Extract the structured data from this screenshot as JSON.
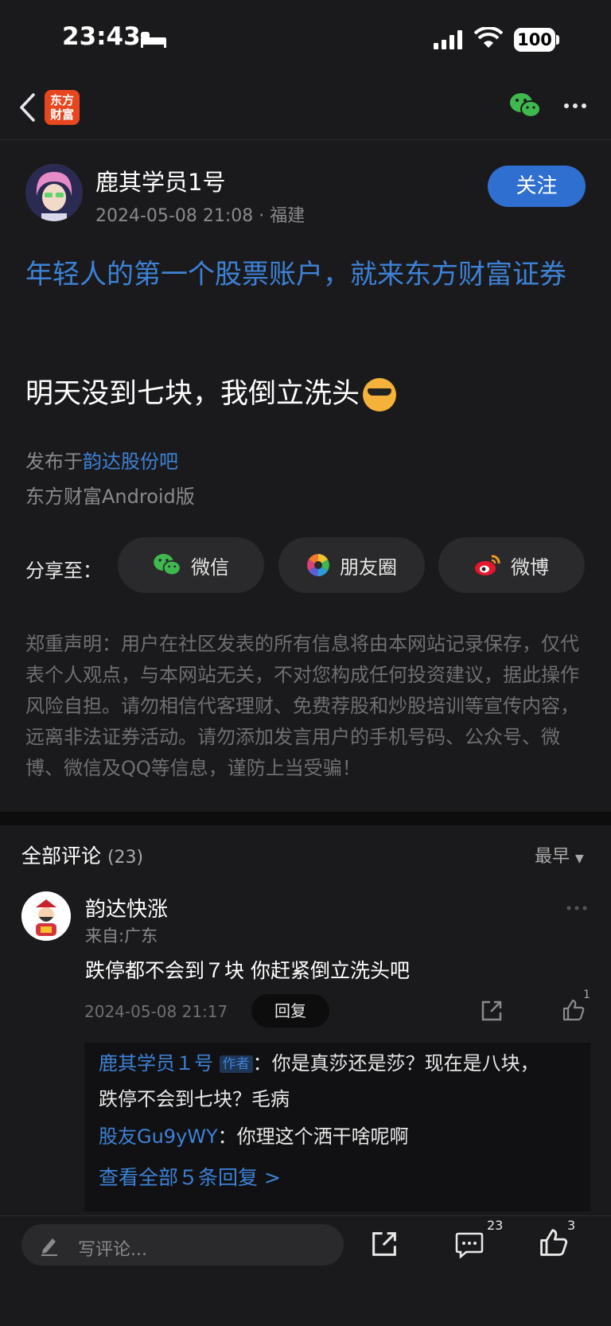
{
  "status": {
    "time": "23:43",
    "battery": "100"
  },
  "nav": {
    "logo_text": "东方\n财富"
  },
  "post": {
    "author": "鹿其学员1号",
    "meta": "2024-05-08 21:08 · 福建",
    "follow_label": "关注",
    "promo": "年轻人的第一个股票账户，就来东方财富证券",
    "body": "明天没到七块，我倒立洗头",
    "published_prefix": "发布于",
    "published_link": "韵达股份吧",
    "client": "东方财富Android版"
  },
  "share": {
    "label": "分享至：",
    "buttons": [
      "微信",
      "朋友圈",
      "微博"
    ]
  },
  "disclaimer": "郑重声明：用户在社区发表的所有信息将由本网站记录保存，仅代表个人观点，与本网站无关，不对您构成任何投资建议，据此操作风险自担。请勿相信代客理财、免费荐股和炒股培训等宣传内容，远离非法证券活动。请勿添加发言用户的手机号码、公众号、微博、微信及QQ等信息，谨防上当受骗！",
  "comments": {
    "title": "全部评论",
    "count": "(23)",
    "sort": "最早",
    "items": [
      {
        "name": "韵达快涨",
        "location": "来自:广东",
        "text": "跌停都不会到７块 你赶紧倒立洗头吧",
        "time": "2024-05-08 21:17",
        "reply_label": "回复",
        "likes": "1",
        "replies": [
          {
            "user": "鹿其学员１号",
            "tag": "作者",
            "text": "：你是真莎还是莎？现在是八块，跌停不会到七块？毛病"
          },
          {
            "user": "股友Gu9yWY",
            "text": "：你理这个洒干啥呢啊"
          }
        ],
        "view_all": "查看全部５条回复 >"
      }
    ]
  },
  "bottom": {
    "placeholder": "写评论...",
    "comment_count": "23",
    "like_count": "3"
  }
}
